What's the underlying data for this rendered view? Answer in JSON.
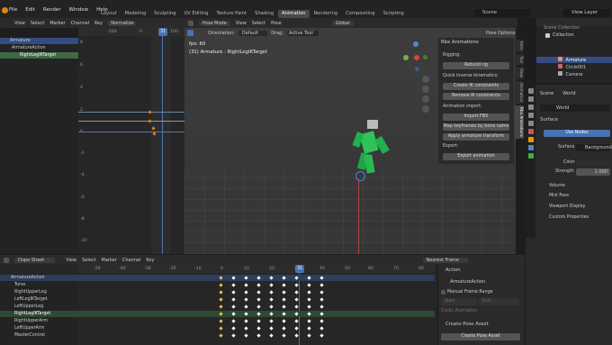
{
  "topbar": {
    "menus": [
      "File",
      "Edit",
      "Render",
      "Window",
      "Help"
    ],
    "workspaces": [
      "Layout",
      "Modeling",
      "Sculpting",
      "UV Editing",
      "Texture Paint",
      "Shading",
      "Animation",
      "Rendering",
      "Compositing",
      "Scripting"
    ],
    "active_workspace": "Animation",
    "scene": "Scene",
    "view_layer": "View Layer"
  },
  "graph_editor": {
    "header": [
      "View",
      "Select",
      "Marker",
      "Channel",
      "Key"
    ],
    "normalize": "Normalize",
    "frame_ticks": [
      "-100",
      "0",
      "100"
    ],
    "current_frame": "31",
    "value_ticks": [
      "8",
      "6",
      "4",
      "2",
      "0",
      "-2",
      "-4",
      "-6",
      "-8",
      "-10"
    ],
    "channels": [
      "Armature",
      "ArmatureAction",
      "RightLegIKTarget"
    ]
  },
  "viewport": {
    "mode": "Pose Mode",
    "header": [
      "View",
      "Select",
      "Pose"
    ],
    "orientation_label": "Orientation:",
    "orientation": "Default",
    "drag_label": "Drag:",
    "drag": "Active Tool",
    "transform": "Global",
    "pose_options": "Pose Options",
    "fps": "fps: 60",
    "object_info": "(31) Armature : RightLegIKTarget"
  },
  "rbx_panel": {
    "title": "Rbx Animations",
    "rigging_label": "Rigging:",
    "rebuild": "Rebuild rig",
    "ik_label": "Quick inverse kinematics:",
    "create_ik": "Create IK constraints",
    "remove_ik": "Remove IK constraints",
    "import_label": "Animation import:",
    "import_fbx": "Import FBX",
    "map_keyframes": "Map keyframes by bone name",
    "apply_transform": "Apply armature transform",
    "export_label": "Export:",
    "export_anim": "Export animation"
  },
  "viewport_tabs": [
    "Item",
    "Tool",
    "View",
    "Animation",
    "Rbx Animations"
  ],
  "outliner": {
    "root": "Scene Collection",
    "items": [
      "Collection",
      "Armature",
      "Circle001",
      "Camera"
    ]
  },
  "properties": {
    "scene_label": "Scene",
    "world_label": "World",
    "world_name": "World",
    "surface_header": "Surface",
    "use_nodes": "Use Nodes",
    "surface_label": "Surface",
    "surface_value": "Background",
    "color_label": "Color",
    "strength_label": "Strength",
    "strength_value": "1.000",
    "sections": [
      "Volume",
      "Mist Pass",
      "Viewport Display",
      "Custom Properties"
    ]
  },
  "dopesheet": {
    "mode": "Dope Sheet",
    "header": [
      "View",
      "Select",
      "Marker",
      "Channel",
      "Key"
    ],
    "snap": "Nearest Frame",
    "ticks": [
      "-50",
      "-40",
      "-30",
      "-20",
      "-10",
      "0",
      "10",
      "20",
      "30",
      "40",
      "50",
      "60",
      "70",
      "80"
    ],
    "current_frame": "31",
    "channels": [
      "ArmatureAction",
      "Torso",
      "RightUpperLeg",
      "LeftLegIKTarget",
      "LeftUpperLeg",
      "RightLegIKTarget",
      "RightUpperArm",
      "LeftUpperArm",
      "MasterControl"
    ]
  },
  "action_panel": {
    "title": "Action",
    "action_name": "ArmatureAction",
    "manual_range": "Manual Frame Range",
    "start_label": "Start",
    "end_label": "End",
    "cyclic": "Cyclic Animation",
    "create_pose_header": "Create Pose Asset",
    "create_pose_btn": "Create Pose Asset"
  },
  "colors": {
    "accent": "#4772b3",
    "active_ws": "#4a4a4a",
    "keyframe": "#e8c25b",
    "selected_key": "#ffffff"
  }
}
